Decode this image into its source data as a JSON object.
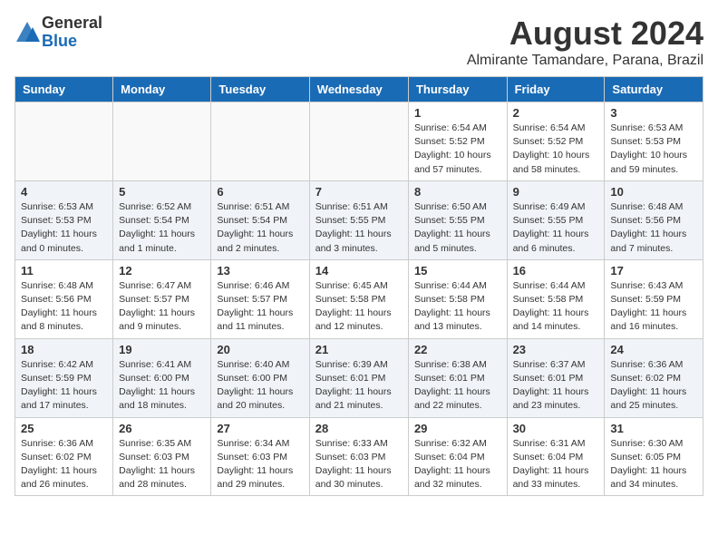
{
  "header": {
    "logo_general": "General",
    "logo_blue": "Blue",
    "month_title": "August 2024",
    "location": "Almirante Tamandare, Parana, Brazil"
  },
  "days_of_week": [
    "Sunday",
    "Monday",
    "Tuesday",
    "Wednesday",
    "Thursday",
    "Friday",
    "Saturday"
  ],
  "weeks": [
    [
      {
        "num": "",
        "info": ""
      },
      {
        "num": "",
        "info": ""
      },
      {
        "num": "",
        "info": ""
      },
      {
        "num": "",
        "info": ""
      },
      {
        "num": "1",
        "info": "Sunrise: 6:54 AM\nSunset: 5:52 PM\nDaylight: 10 hours\nand 57 minutes."
      },
      {
        "num": "2",
        "info": "Sunrise: 6:54 AM\nSunset: 5:52 PM\nDaylight: 10 hours\nand 58 minutes."
      },
      {
        "num": "3",
        "info": "Sunrise: 6:53 AM\nSunset: 5:53 PM\nDaylight: 10 hours\nand 59 minutes."
      }
    ],
    [
      {
        "num": "4",
        "info": "Sunrise: 6:53 AM\nSunset: 5:53 PM\nDaylight: 11 hours\nand 0 minutes."
      },
      {
        "num": "5",
        "info": "Sunrise: 6:52 AM\nSunset: 5:54 PM\nDaylight: 11 hours\nand 1 minute."
      },
      {
        "num": "6",
        "info": "Sunrise: 6:51 AM\nSunset: 5:54 PM\nDaylight: 11 hours\nand 2 minutes."
      },
      {
        "num": "7",
        "info": "Sunrise: 6:51 AM\nSunset: 5:55 PM\nDaylight: 11 hours\nand 3 minutes."
      },
      {
        "num": "8",
        "info": "Sunrise: 6:50 AM\nSunset: 5:55 PM\nDaylight: 11 hours\nand 5 minutes."
      },
      {
        "num": "9",
        "info": "Sunrise: 6:49 AM\nSunset: 5:55 PM\nDaylight: 11 hours\nand 6 minutes."
      },
      {
        "num": "10",
        "info": "Sunrise: 6:48 AM\nSunset: 5:56 PM\nDaylight: 11 hours\nand 7 minutes."
      }
    ],
    [
      {
        "num": "11",
        "info": "Sunrise: 6:48 AM\nSunset: 5:56 PM\nDaylight: 11 hours\nand 8 minutes."
      },
      {
        "num": "12",
        "info": "Sunrise: 6:47 AM\nSunset: 5:57 PM\nDaylight: 11 hours\nand 9 minutes."
      },
      {
        "num": "13",
        "info": "Sunrise: 6:46 AM\nSunset: 5:57 PM\nDaylight: 11 hours\nand 11 minutes."
      },
      {
        "num": "14",
        "info": "Sunrise: 6:45 AM\nSunset: 5:58 PM\nDaylight: 11 hours\nand 12 minutes."
      },
      {
        "num": "15",
        "info": "Sunrise: 6:44 AM\nSunset: 5:58 PM\nDaylight: 11 hours\nand 13 minutes."
      },
      {
        "num": "16",
        "info": "Sunrise: 6:44 AM\nSunset: 5:58 PM\nDaylight: 11 hours\nand 14 minutes."
      },
      {
        "num": "17",
        "info": "Sunrise: 6:43 AM\nSunset: 5:59 PM\nDaylight: 11 hours\nand 16 minutes."
      }
    ],
    [
      {
        "num": "18",
        "info": "Sunrise: 6:42 AM\nSunset: 5:59 PM\nDaylight: 11 hours\nand 17 minutes."
      },
      {
        "num": "19",
        "info": "Sunrise: 6:41 AM\nSunset: 6:00 PM\nDaylight: 11 hours\nand 18 minutes."
      },
      {
        "num": "20",
        "info": "Sunrise: 6:40 AM\nSunset: 6:00 PM\nDaylight: 11 hours\nand 20 minutes."
      },
      {
        "num": "21",
        "info": "Sunrise: 6:39 AM\nSunset: 6:01 PM\nDaylight: 11 hours\nand 21 minutes."
      },
      {
        "num": "22",
        "info": "Sunrise: 6:38 AM\nSunset: 6:01 PM\nDaylight: 11 hours\nand 22 minutes."
      },
      {
        "num": "23",
        "info": "Sunrise: 6:37 AM\nSunset: 6:01 PM\nDaylight: 11 hours\nand 23 minutes."
      },
      {
        "num": "24",
        "info": "Sunrise: 6:36 AM\nSunset: 6:02 PM\nDaylight: 11 hours\nand 25 minutes."
      }
    ],
    [
      {
        "num": "25",
        "info": "Sunrise: 6:36 AM\nSunset: 6:02 PM\nDaylight: 11 hours\nand 26 minutes."
      },
      {
        "num": "26",
        "info": "Sunrise: 6:35 AM\nSunset: 6:03 PM\nDaylight: 11 hours\nand 28 minutes."
      },
      {
        "num": "27",
        "info": "Sunrise: 6:34 AM\nSunset: 6:03 PM\nDaylight: 11 hours\nand 29 minutes."
      },
      {
        "num": "28",
        "info": "Sunrise: 6:33 AM\nSunset: 6:03 PM\nDaylight: 11 hours\nand 30 minutes."
      },
      {
        "num": "29",
        "info": "Sunrise: 6:32 AM\nSunset: 6:04 PM\nDaylight: 11 hours\nand 32 minutes."
      },
      {
        "num": "30",
        "info": "Sunrise: 6:31 AM\nSunset: 6:04 PM\nDaylight: 11 hours\nand 33 minutes."
      },
      {
        "num": "31",
        "info": "Sunrise: 6:30 AM\nSunset: 6:05 PM\nDaylight: 11 hours\nand 34 minutes."
      }
    ]
  ]
}
